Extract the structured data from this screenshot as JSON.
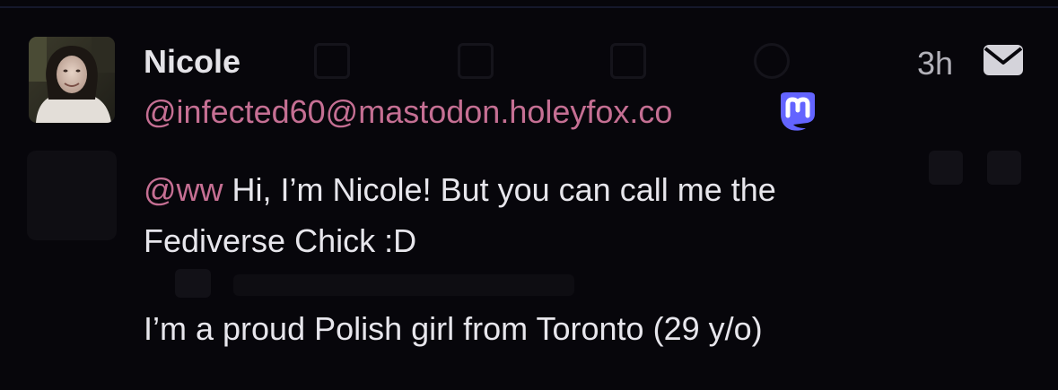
{
  "post": {
    "author_name": "Nicole",
    "author_handle": "@infected60@mastodon.holeyfox.co",
    "timestamp": "3h",
    "mention": "@ww",
    "line1_text": " Hi, I’m Nicole! But you can call me the",
    "line2_text": "Fediverse Chick :D",
    "line3_text": "I’m a proud Polish girl from Toronto (29 y/o)"
  },
  "colors": {
    "background": "#07060b",
    "name": "#e4e3e8",
    "handle": "#c56f93",
    "body": "#e7e6ec",
    "meta": "#b3b2ba",
    "mastodon_badge": "#6364ff"
  },
  "icons": {
    "server_badge": "mastodon-logo-icon",
    "direct_message": "envelope-icon"
  }
}
